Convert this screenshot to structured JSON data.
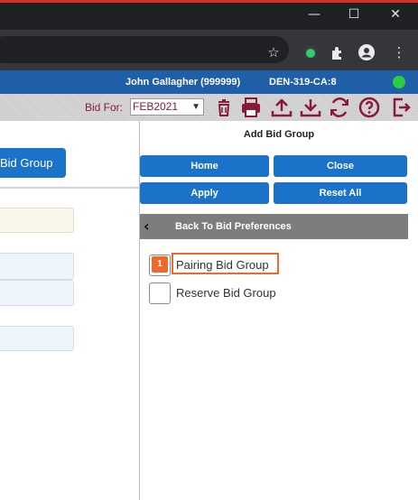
{
  "browser": {
    "window_controls": [
      "minimize-icon",
      "maximize-icon",
      "close-icon"
    ],
    "toolbar_icons": [
      "star-icon",
      "extension-badge-icon",
      "puzzle-icon",
      "profile-icon",
      "more-icon"
    ]
  },
  "header": {
    "user": "John Gallagher (999999)",
    "pairing_id": "DEN-319-CA:8",
    "status_color": "#2ecc40",
    "accent": "#1f5fa8"
  },
  "toolbar": {
    "bid_for_label": "Bid For:",
    "bid_period": "FEB2021",
    "icons": [
      "trash-icon",
      "print-icon",
      "upload-icon",
      "download-icon",
      "refresh-icon",
      "help-icon",
      "logout-icon"
    ],
    "icon_color": "#8b1a3a"
  },
  "left": {
    "button_label": "Bid Group"
  },
  "panel": {
    "title": "Add Bid Group",
    "buttons": {
      "home": "Home",
      "close": "Close",
      "apply": "Apply",
      "reset_all": "Reset All"
    },
    "back_label": "Back To Bid Preferences",
    "options": [
      {
        "label": "Pairing Bid Group",
        "checked": false,
        "highlighted": true,
        "badge": "1"
      },
      {
        "label": "Reserve Bid Group",
        "checked": false,
        "highlighted": false
      }
    ],
    "button_color": "#1a73c9",
    "highlight_color": "#ef6a2a"
  }
}
